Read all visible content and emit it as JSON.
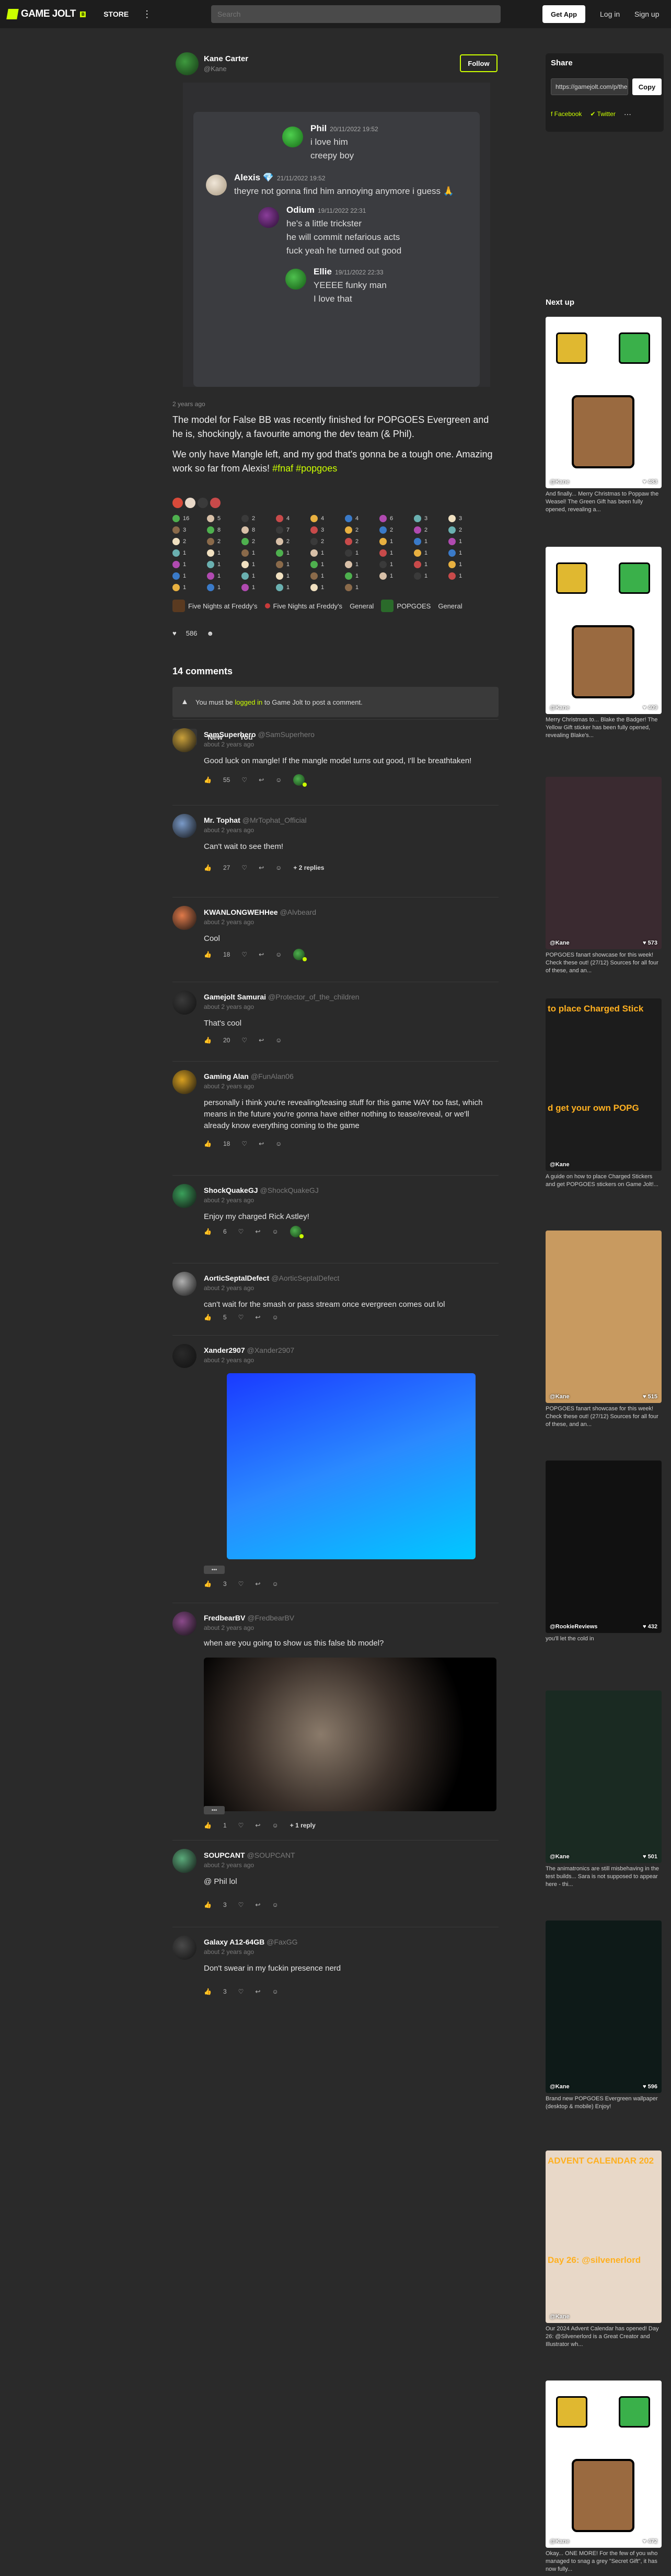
{
  "nav": {
    "logo": "GAME JOLT",
    "logo_sub": "Β",
    "store": "STORE",
    "more": "⋮",
    "search_placeholder": "Search",
    "get_app": "Get App",
    "login": "Log in",
    "signup": "Sign up"
  },
  "post": {
    "author_name": "Kane Carter",
    "author_handle": "@Kane",
    "follow_label": "Follow",
    "posted_ago": "2 years ago",
    "paragraphs": [
      "The model for False BB was recently finished for POPGOES Evergreen and he is, shockingly, a favourite among the dev team (& Phil).",
      "We only have Mangle left, and my god that's gonna be a tough one. Amazing work so far from Alexis!"
    ],
    "hashtags": [
      "#fnaf",
      "#popgoes"
    ],
    "image_messages": [
      {
        "name": "Phil",
        "time": "20/11/2022 19:52",
        "lines": [
          "i love him",
          "creepy boy"
        ],
        "color": "#3db83d"
      },
      {
        "name": "Alexis 💎",
        "time": "21/11/2022 19:52",
        "lines": [
          "theyre not gonna find him annoying anymore i guess 🙏"
        ],
        "color": "#d8cbb8"
      },
      {
        "name": "Odium",
        "time": "19/11/2022 22:31",
        "lines": [
          "he's a little trickster",
          "he will commit nefarious acts",
          "fuck yeah he turned out good"
        ],
        "color": "#6a2d7a"
      },
      {
        "name": "Ellie",
        "time": "19/11/2022 22:33",
        "lines": [
          "YEEEE funky man",
          "I love that"
        ],
        "color": "#3aa03a"
      }
    ],
    "reactions": [
      "16",
      "5",
      "2",
      "4",
      "4",
      "4",
      "6",
      "3",
      "3",
      "3",
      "8",
      "8",
      "7",
      "3",
      "2",
      "2",
      "2",
      "2",
      "2",
      "2",
      "2",
      "2",
      "2",
      "2",
      "1",
      "1",
      "1",
      "1",
      "1",
      "1",
      "1",
      "1",
      "1",
      "1",
      "1",
      "1",
      "1",
      "1",
      "1",
      "1",
      "1",
      "1",
      "1",
      "1",
      "1",
      "1",
      "1",
      "1",
      "1",
      "1",
      "1",
      "1",
      "1",
      "1",
      "1",
      "1",
      "1",
      "1",
      "1",
      "1"
    ],
    "tags": [
      "Five Nights at Freddy's",
      "Five Nights at Freddy's",
      "General",
      "POPGOES",
      "General"
    ],
    "like_count": "586"
  },
  "comments_section": {
    "title": "14 comments",
    "login_prefix": "You must be",
    "login_link": "logged in",
    "login_suffix": "to Game Jolt to post a comment.",
    "sort_tabs": [
      "Hot",
      "New",
      "You"
    ]
  },
  "comments": [
    {
      "name": "SamSuperhero",
      "handle": "@SamSuperhero",
      "time": "about 2 years ago",
      "text": "Good luck on mangle! If the mangle model turns out good, I'll be breathtaken!",
      "likes": "55",
      "replies": "",
      "avatar": "#c9a03a"
    },
    {
      "name": "Mr. Tophat",
      "handle": "@MrTophat_Official",
      "time": "about 2 years ago",
      "text": "Can't wait to see them!",
      "likes": "27",
      "replies": "+ 2 replies",
      "avatar": "#7a9ac8"
    },
    {
      "name": "KWANLONGWEHHee",
      "handle": "@Alvbeard",
      "time": "about 2 years ago",
      "text": "Cool",
      "likes": "18",
      "replies": "",
      "avatar": "#e07a4a"
    },
    {
      "name": "Gamejolt Samurai",
      "handle": "@Protector_of_the_children",
      "time": "about 2 years ago",
      "text": "That's cool",
      "likes": "20",
      "replies": "",
      "avatar": "#3a3a3a"
    },
    {
      "name": "Gaming Alan",
      "handle": "@FunAlan06",
      "time": "about 2 years ago",
      "text": "personally i think you're revealing/teasing stuff for this game WAY too fast, which means in the future you're gonna have either nothing to tease/reveal, or we'll already know everything coming to the game",
      "likes": "18",
      "replies": "",
      "avatar": "#d8a020"
    },
    {
      "name": "ShockQuakeGJ",
      "handle": "@ShockQuakeGJ",
      "time": "about 2 years ago",
      "text": "Enjoy my charged Rick Astley!",
      "likes": "6",
      "replies": "",
      "avatar": "#3aa05a"
    },
    {
      "name": "AorticSeptalDefect",
      "handle": "@AorticSeptalDefect",
      "time": "about 2 years ago",
      "text": "can't wait for the smash or pass stream once evergreen comes out lol",
      "likes": "5",
      "replies": "",
      "avatar": "#b0b0b0"
    },
    {
      "name": "Xander2907",
      "handle": "@Xander2907",
      "time": "about 2 years ago",
      "text": "",
      "likes": "3",
      "replies": "",
      "avatar": "#2a2a2a"
    },
    {
      "name": "FredbearBV",
      "handle": "@FredbearBV",
      "time": "about 2 years ago",
      "text": "when are you going to show us this false bb model?",
      "likes": "1",
      "replies": "+ 1 reply",
      "avatar": "#8a4a8a"
    },
    {
      "name": "SOUPCANT",
      "handle": "@SOUPCANT",
      "time": "about 2 years ago",
      "text": "@ Phil lol",
      "likes": "3",
      "replies": "",
      "avatar": "#5aaa7a"
    },
    {
      "name": "Galaxy A12-64GB",
      "handle": "@FaxGG",
      "time": "about 2 years ago",
      "text": "Don't swear in my fuckin presence nerd",
      "likes": "3",
      "replies": "",
      "avatar": "#4a4a4a"
    }
  ],
  "image_toggle_label": "•••",
  "sidebar": {
    "share_title": "Share",
    "share_url": "https://gamejolt.com/p/the-model-for-false-bb",
    "copy_label": "Copy",
    "facebook": "Facebook",
    "twitter": "Twitter",
    "share_more": "···",
    "next_up": "Next up",
    "cards": [
      {
        "author": "@Kane",
        "likes": "483",
        "desc": "And finally... Merry Christmas to Poppaw the Weasel! The Green Gift has been fully opened, revealing a...",
        "bg": "#ffffff"
      },
      {
        "author": "@Kane",
        "likes": "409",
        "desc": "Merry Christmas to... Blake the Badger! The Yellow Gift sticker has been fully opened, revealing Blake's...",
        "bg": "#ffffff"
      },
      {
        "author": "@Kane",
        "likes": "573",
        "desc": "POPGOES fanart showcase for this week! Check these out! (27/12) Sources for all four of these, and an...",
        "bg": "#3a2a30"
      },
      {
        "author": "@Kane",
        "likes": "",
        "desc": "A guide on how to place Charged Stickers and get POPGOES stickers on Game Jolt!...",
        "bg": "#1c1c1c",
        "heading": "to place Charged Stick",
        "sub_heading": "d get your own POPG"
      },
      {
        "author": "@Kane",
        "likes": "515",
        "desc": "POPGOES fanart showcase for this week! Check these out! (27/12) Sources for all four of these, and an...",
        "bg": "#c89a60"
      },
      {
        "author": "@RookieReviews",
        "likes": "432",
        "desc": "you'll let the cold in",
        "bg": "#111111"
      },
      {
        "author": "@Kane",
        "likes": "501",
        "desc": "The animatronics are still misbehaving in the test builds... Sara is not supposed to appear here - thi...",
        "bg": "#1a2a22"
      },
      {
        "author": "@Kane",
        "likes": "596",
        "desc": "Brand new POPGOES Evergreen wallpaper (desktop & mobile) Enjoy!",
        "bg": "#0e1a18"
      },
      {
        "author": "@Kane",
        "likes": "",
        "desc": "Our 2024 Advent Calendar has opened! Day 26: @Silvenerlord is a Great Creator and Illustrator wh...",
        "bg": "#e8d8c8",
        "heading": "ADVENT CALENDAR 202",
        "sub_heading": "Day 26: @silvenerlord"
      },
      {
        "author": "@Kane",
        "likes": "472",
        "desc": "Okay... ONE MORE! For the few of you who managed to snag a grey \"Secret Gift\", it has now fully...",
        "bg": "#ffffff"
      }
    ]
  }
}
